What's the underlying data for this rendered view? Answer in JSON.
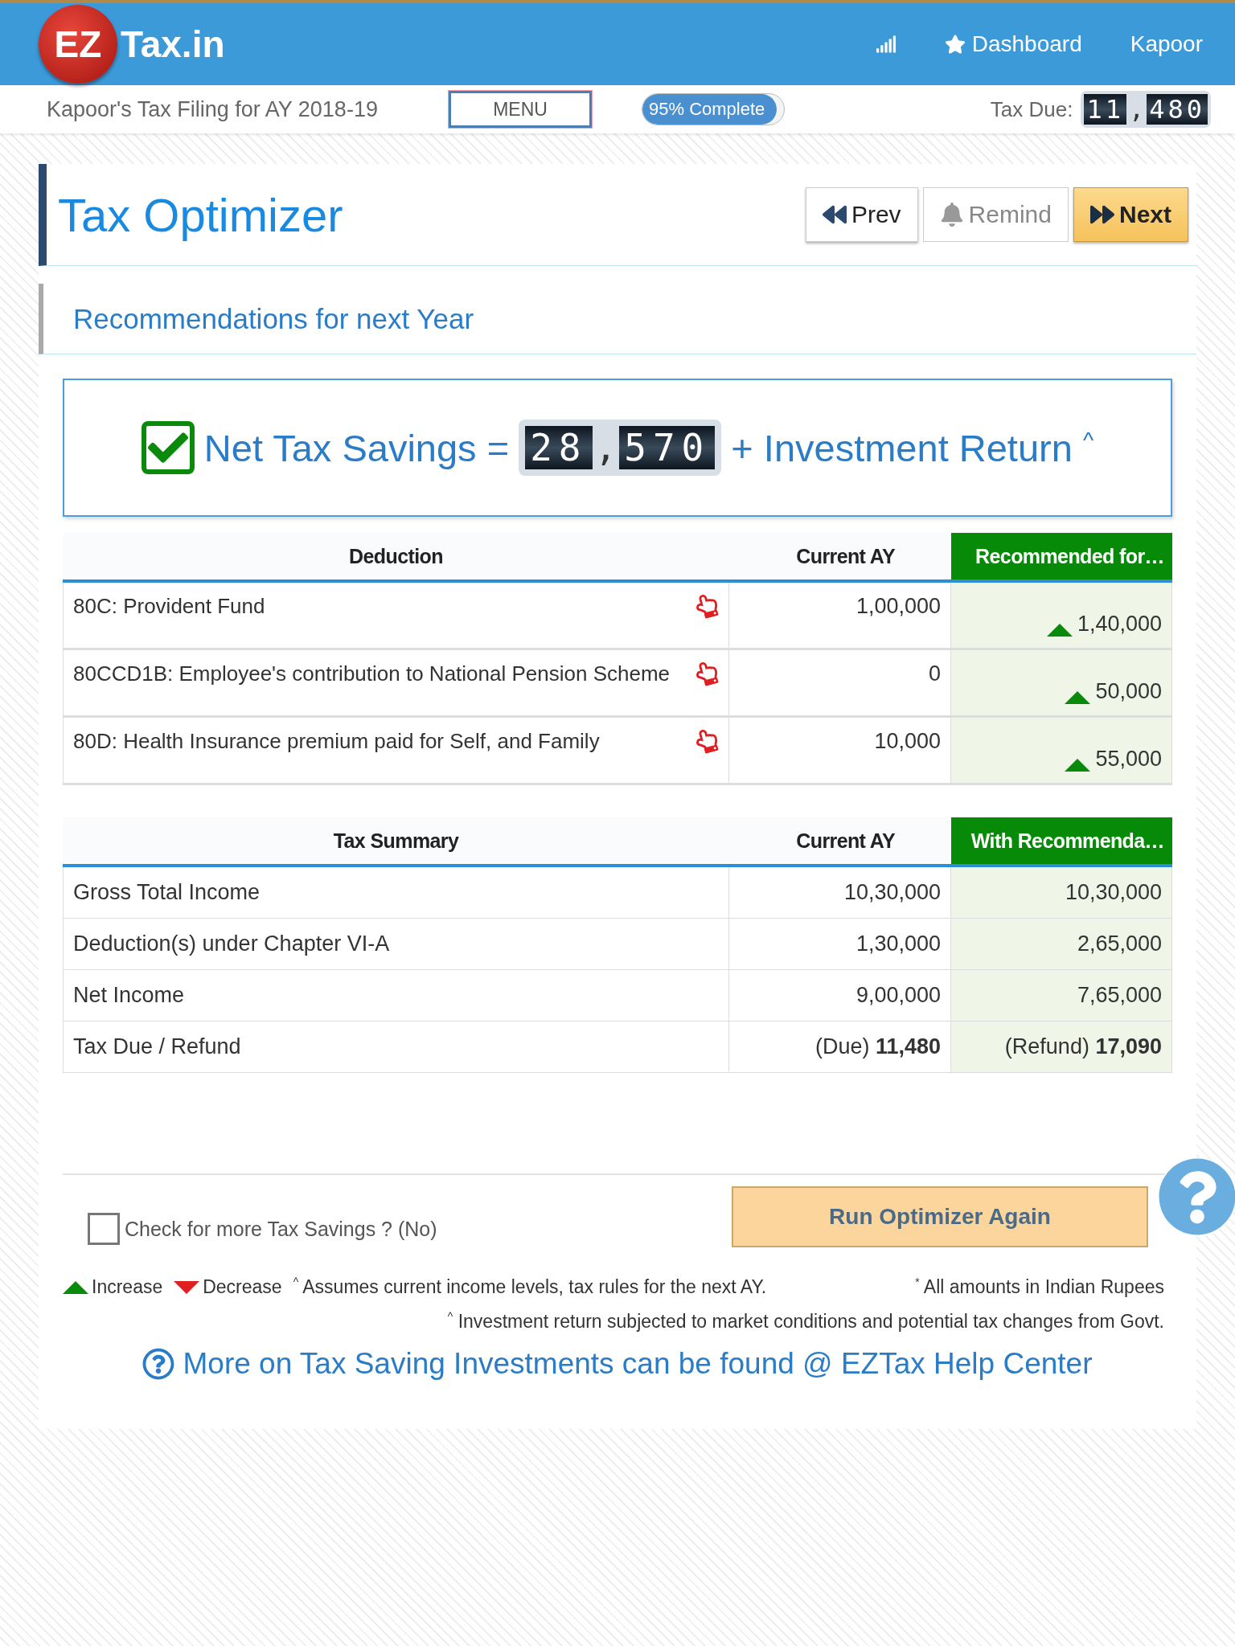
{
  "header": {
    "logo": {
      "badge": "EZ",
      "name": "Tax.in"
    },
    "nav": [
      {
        "label": "Dashboard",
        "kind": "starred"
      },
      {
        "label": "Kapoor",
        "kind": "plain"
      }
    ]
  },
  "subbar": {
    "filing_title": "Kapoor's Tax Filing for AY 2018-19",
    "menu": "MENU",
    "progress": {
      "label": "95% Complete",
      "level": 0.95
    },
    "tax_due": {
      "label": "Tax Due:",
      "value": "11,480"
    }
  },
  "page": {
    "title": "Tax Optimizer",
    "buttons": [
      {
        "label": "Prev",
        "kind": "prev"
      },
      {
        "label": "Remind",
        "kind": "remind"
      },
      {
        "label": "Next",
        "kind": "next"
      }
    ],
    "section_title": "Recommendations for next Year",
    "savings": {
      "label": "Net Tax Savings =",
      "amount": "28,570",
      "suffix": "+ Investment Return",
      "mark": "^"
    }
  },
  "deductions": {
    "columns": [
      "Deduction",
      "Current AY",
      "Recommended for…"
    ],
    "rows": [
      {
        "name": "80C: Provident Fund",
        "current": "1,00,000",
        "recommended": "1,40,000",
        "increased": true
      },
      {
        "name": "80CCD1B: Employee's contribution to National Pension Scheme",
        "current": "0",
        "recommended": "50,000",
        "increased": true
      },
      {
        "name": "80D: Health Insurance premium paid for Self, and Family",
        "current": "10,000",
        "recommended": "55,000",
        "increased": true
      }
    ]
  },
  "summary": {
    "columns": [
      "Tax Summary",
      "Current AY",
      "With Recommenda…"
    ],
    "rows": [
      {
        "name": "Gross Total Income",
        "current": "10,30,000",
        "recommended": "10,30,000"
      },
      {
        "name": "Deduction(s) under Chapter VI-A",
        "current": "1,30,000",
        "recommended": "2,65,000"
      },
      {
        "name": "Net Income",
        "current": "9,00,000",
        "recommended": "7,65,000"
      },
      {
        "name": "Tax Due / Refund",
        "current": "(Due) **11,480**",
        "recommended": "(Refund) **17,090**"
      }
    ]
  },
  "more_savings": {
    "label": "Check for more Tax Savings ? (No)",
    "checked": false
  },
  "run_button": "Run Optimizer Again",
  "legend": {
    "increase": "Increase",
    "decrease": "Decrease",
    "assumption": {
      "mark": "^",
      "text": "Assumes current income levels, tax rules for the next AY."
    },
    "currency_note": {
      "mark": "*",
      "text": "All amounts in Indian Rupees"
    },
    "investment_note": {
      "mark": "^",
      "text": "Investment return subjected to market conditions and potential tax changes from Govt."
    }
  },
  "help_link": "More on Tax Saving Investments can be found @ EZTax Help Center"
}
